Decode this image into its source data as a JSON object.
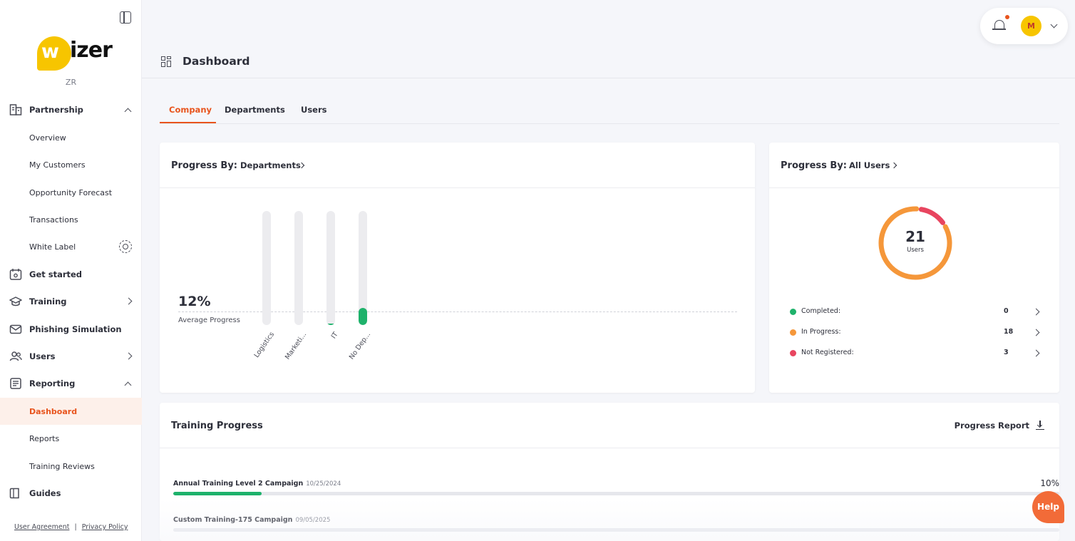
{
  "brand": {
    "logo_mark": "w",
    "logo_text": "izer",
    "org_code": "ZR"
  },
  "sidebar": {
    "items": [
      {
        "label": "Partnership",
        "icon": "building-icon"
      },
      {
        "label": "Overview"
      },
      {
        "label": "My Customers"
      },
      {
        "label": "Opportunity Forecast"
      },
      {
        "label": "Transactions"
      },
      {
        "label": "White Label",
        "icon": "gear-icon"
      },
      {
        "label": "Get started",
        "icon": "calendar-star-icon"
      },
      {
        "label": "Training",
        "icon": "graduation-cap-icon"
      },
      {
        "label": "Phishing Simulation",
        "icon": "envelope-icon"
      },
      {
        "label": "Users",
        "icon": "users-icon"
      },
      {
        "label": "Reporting",
        "icon": "report-icon"
      },
      {
        "label": "Dashboard",
        "active": true
      },
      {
        "label": "Reports"
      },
      {
        "label": "Training Reviews"
      },
      {
        "label": "Guides",
        "icon": "book-icon"
      }
    ],
    "footer": {
      "user_agreement": "User Agreement",
      "separator": "|",
      "privacy_policy": "Privacy Policy"
    }
  },
  "header": {
    "title": "Dashboard",
    "avatar_initial": "M"
  },
  "tabs": [
    {
      "label": "Company",
      "active": true
    },
    {
      "label": "Departments"
    },
    {
      "label": "Users"
    }
  ],
  "department_card": {
    "title": "Progress By:",
    "selector": "Departments",
    "average_value": "12%",
    "average_label": "Average Progress",
    "chart_data": {
      "type": "bar",
      "categories": [
        "Logistics",
        "Marketi...",
        "IT",
        "No Dep..."
      ],
      "values": [
        0,
        0,
        1,
        15
      ],
      "ylim": [
        0,
        100
      ],
      "average": 12
    }
  },
  "users_card": {
    "title": "Progress By:",
    "selector": "All Users",
    "total": "21",
    "total_label": "Users",
    "legend": [
      {
        "label": "Completed:",
        "value": "0",
        "color": "#1eb26b"
      },
      {
        "label": "In Progress:",
        "value": "18",
        "color": "#f5973a"
      },
      {
        "label": "Not Registered:",
        "value": "3",
        "color": "#e8455f"
      }
    ],
    "chart_data": {
      "type": "pie",
      "categories": [
        "Completed",
        "In Progress",
        "Not Registered"
      ],
      "values": [
        0,
        18,
        3
      ]
    }
  },
  "training_card": {
    "title": "Training Progress",
    "report_link": "Progress Report",
    "campaigns": [
      {
        "name": "Annual Training Level 2 Campaign",
        "date": "10/25/2024",
        "percent": "10%",
        "progress": 0.1
      },
      {
        "name": "Custom Training-175 Campaign",
        "date": "09/05/2025",
        "percent": "",
        "progress": 0
      }
    ]
  },
  "help": {
    "label": "Help"
  },
  "colors": {
    "accent": "#e8541d",
    "success": "#1eb26b",
    "progress": "#f5973a",
    "danger": "#e8455f"
  }
}
